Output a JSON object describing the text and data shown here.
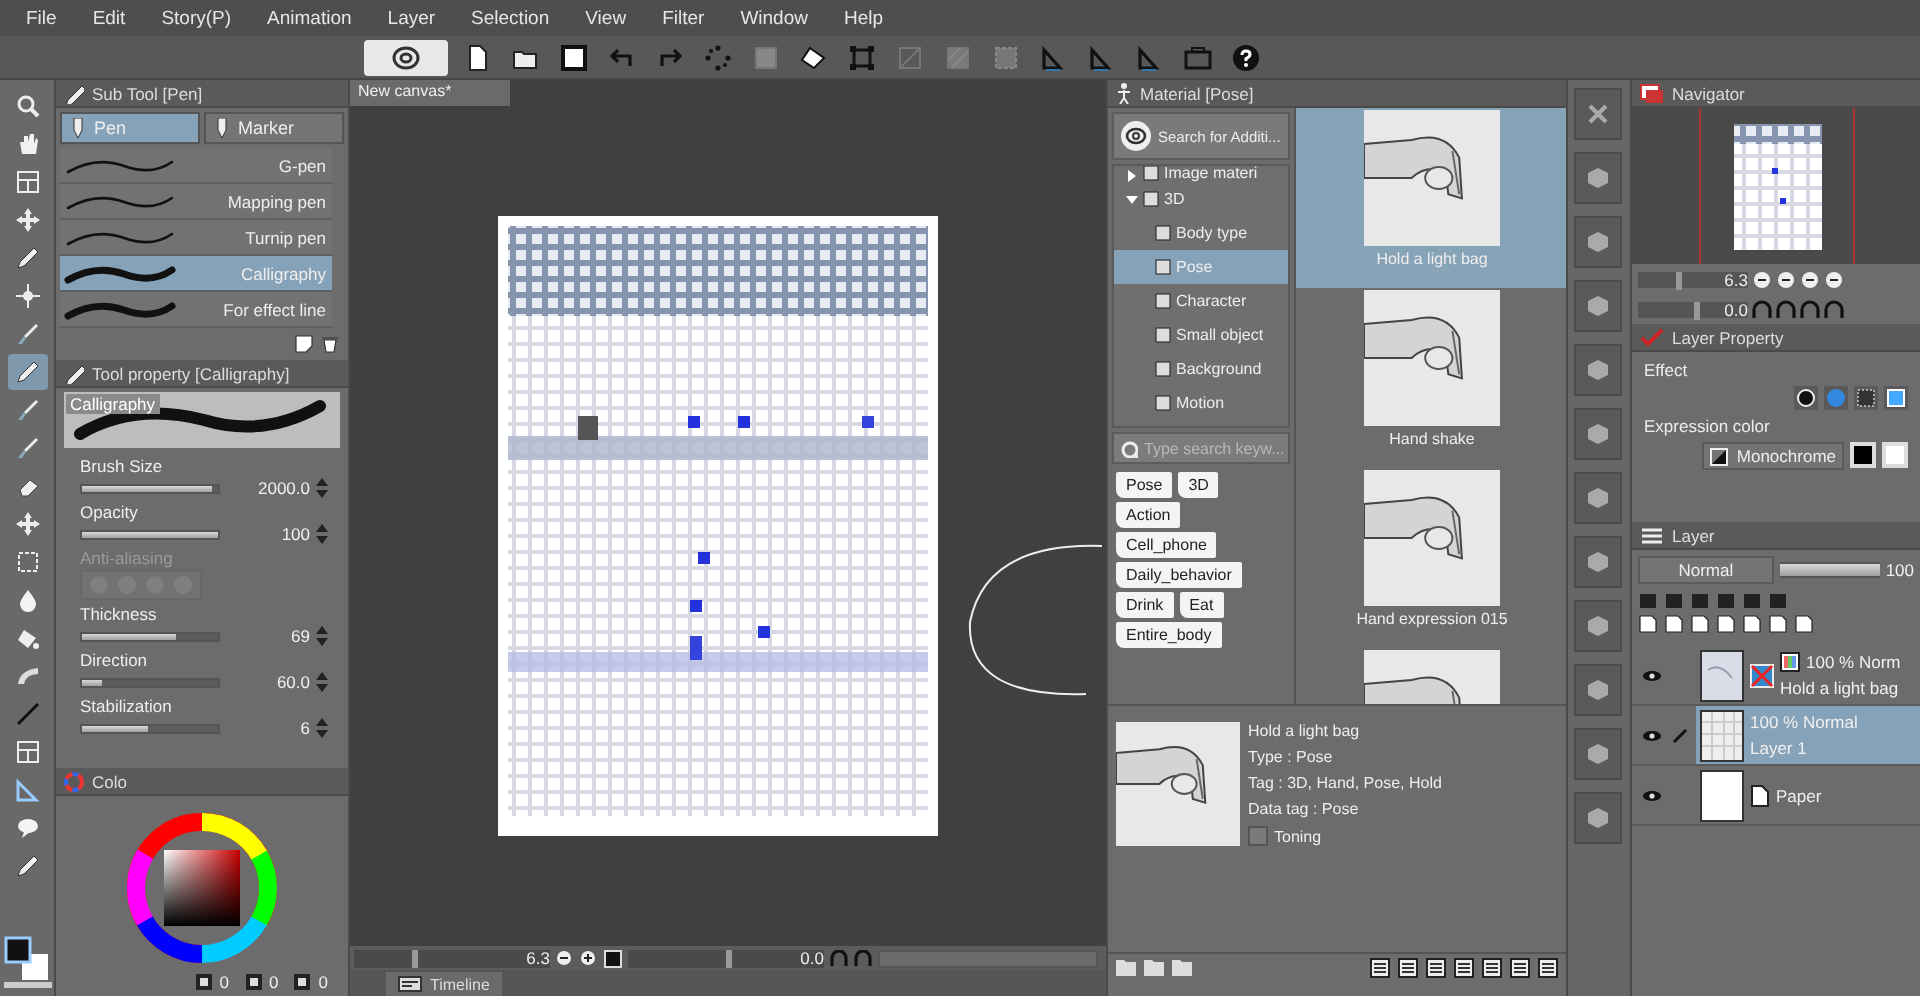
{
  "menu": [
    "File",
    "Edit",
    "Story(P)",
    "Animation",
    "Layer",
    "Selection",
    "View",
    "Filter",
    "Window",
    "Help"
  ],
  "sub_tool": {
    "title": "Sub Tool [Pen]",
    "groups": [
      {
        "label": "Pen",
        "selected": true
      },
      {
        "label": "Marker",
        "selected": false
      }
    ],
    "brushes": [
      {
        "name": "G-pen",
        "selected": false
      },
      {
        "name": "Mapping pen",
        "selected": false
      },
      {
        "name": "Turnip pen",
        "selected": false
      },
      {
        "name": "Calligraphy",
        "selected": true
      },
      {
        "name": "For effect line",
        "selected": false
      }
    ]
  },
  "tool_property": {
    "title": "Tool property [Calligraphy]",
    "preview_label": "Calligraphy",
    "settings": [
      {
        "kind": "slider",
        "label": "Brush Size",
        "value": "2000.0",
        "level": 0.95
      },
      {
        "kind": "slider",
        "label": "Opacity",
        "value": "100",
        "level": 1
      },
      {
        "kind": "dots",
        "label": "Anti-aliasing",
        "disabled": true
      },
      {
        "kind": "slider",
        "label": "Thickness",
        "value": "69",
        "level": 0.69
      },
      {
        "kind": "slider",
        "label": "Direction",
        "value": "60.0",
        "level": 0.15
      },
      {
        "kind": "slider",
        "label": "Stabilization",
        "value": "6",
        "level": 0.48
      }
    ]
  },
  "color": {
    "tab": "Colo",
    "values": [
      "0",
      "0",
      "0"
    ]
  },
  "canvas": {
    "tab": "New canvas*",
    "zoom": {
      "reading": "6.3",
      "level": 0.3
    },
    "rotation": {
      "reading": "0.0",
      "level": 0.5
    }
  },
  "timeline": {
    "tab": "Timeline"
  },
  "material": {
    "title": "Material [Pose]",
    "search_button": "Search for Additi...",
    "tree": [
      {
        "label": "Image materi",
        "expanded": false
      },
      {
        "label": "3D",
        "expanded": true,
        "selected": false,
        "children": [
          {
            "label": "Body type",
            "selected": false
          },
          {
            "label": "Pose",
            "selected": true
          },
          {
            "label": "Character",
            "selected": false
          },
          {
            "label": "Small object",
            "selected": false
          },
          {
            "label": "Background",
            "selected": false
          },
          {
            "label": "Motion",
            "selected": false
          }
        ]
      }
    ],
    "keyword_placeholder": "Type search keyw...",
    "tags": [
      "Pose",
      "3D",
      "Action",
      "Cell_phone",
      "Daily_behavior",
      "Drink",
      "Eat",
      "Entire_body"
    ],
    "items": [
      {
        "kind": "picture",
        "label": "Hold a light bag",
        "selected": true
      },
      {
        "kind": "picture",
        "label": "Hand shake",
        "selected": false
      },
      {
        "kind": "picture",
        "label": "Hand expression 015",
        "selected": false
      },
      {
        "kind": "picture",
        "selected": false
      }
    ],
    "detail": {
      "name": "Hold a light bag",
      "type": "Type : Pose",
      "tag": "Tag : 3D, Hand, Pose, Hold",
      "data_tag": "Data tag : Pose",
      "toning": {
        "label": "Toning",
        "checked": false
      }
    }
  },
  "navigator": {
    "title": "Navigator",
    "zoom": {
      "reading": "6.3",
      "level": 0.35
    },
    "rotation": {
      "reading": "0.0",
      "level": 0.5
    }
  },
  "layer_property": {
    "title": "Layer Property",
    "effect_label": "Effect",
    "expression_label": "Expression color",
    "expression_value": "Monochrome"
  },
  "layers": {
    "title": "Layer",
    "blend_mode": "Normal",
    "opacity": {
      "reading": "100",
      "level": 1
    },
    "items": [
      {
        "kind": "model",
        "info": "100 % Norm",
        "name": "Hold a light bag",
        "selected": false,
        "visible": true
      },
      {
        "kind": "raster",
        "info": "100 % Normal",
        "name": "Layer 1",
        "selected": true,
        "visible": true
      },
      {
        "kind": "paper",
        "name": "Paper",
        "selected": false,
        "visible": true
      }
    ]
  }
}
